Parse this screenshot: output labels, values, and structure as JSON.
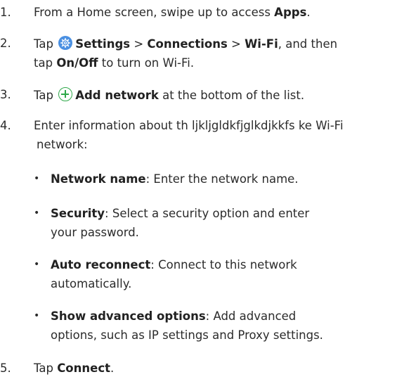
{
  "steps": [
    {
      "num": "1.",
      "pre": "From a Home screen, swipe up to access ",
      "bold": "Apps",
      "post": "."
    },
    {
      "num": "2.",
      "pre": "Tap ",
      "icon": "settings-icon",
      "b1": "Settings",
      "sep1": " > ",
      "b2": "Connections",
      "sep2": " > ",
      "b3": "Wi-Fi",
      "post": ", and then",
      "line2_pre": "tap ",
      "line2_bold": "On/Off",
      "line2_post": " to turn on Wi-Fi."
    },
    {
      "num": "3.",
      "pre": "Tap ",
      "icon": "add-icon",
      "bold": "Add network",
      "post": " at the bottom of the list."
    },
    {
      "num": "4.",
      "line1": "Enter information about th ljkljgldkfjglkdjkkfs ke Wi-Fi",
      "line2": "network:"
    },
    {
      "num": "5.",
      "pre": "Tap ",
      "bold": "Connect",
      "post": "."
    }
  ],
  "bullets": [
    {
      "bold": "Network name",
      "text": ": Enter the network name.",
      "line2": ""
    },
    {
      "bold": "Security",
      "text": ": Select a security option and enter",
      "line2": "your password."
    },
    {
      "bold": "Auto reconnect",
      "text": ": Connect to this network",
      "line2": "automatically."
    },
    {
      "bold": "Show advanced options",
      "text": ": Add advanced",
      "line2": "options, such as IP settings and Proxy settings."
    }
  ],
  "bullet_char": "•",
  "colors": {
    "settings_icon": "#4a90e2",
    "add_icon": "#2fa84a"
  }
}
